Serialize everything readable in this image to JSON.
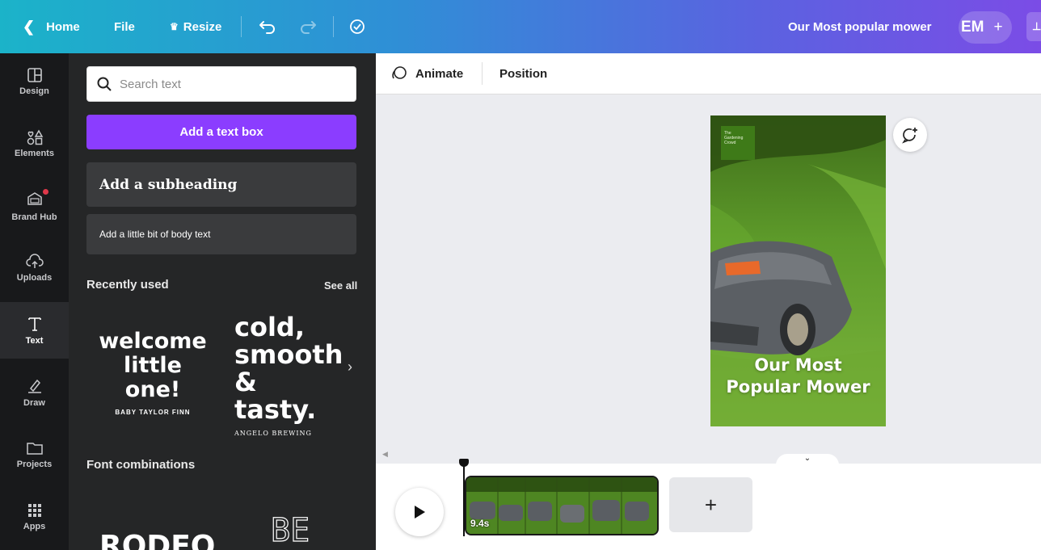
{
  "topbar": {
    "home_label": "Home",
    "file_label": "File",
    "resize_label": "Resize",
    "design_title": "Our Most popular mower",
    "avatar_initials": "EM",
    "avatar_add": "+"
  },
  "rail": {
    "items": [
      {
        "label": "Design",
        "icon": "layout-icon"
      },
      {
        "label": "Elements",
        "icon": "shapes-icon"
      },
      {
        "label": "Brand Hub",
        "icon": "brand-hub-icon"
      },
      {
        "label": "Uploads",
        "icon": "cloud-upload-icon"
      },
      {
        "label": "Text",
        "icon": "text-icon"
      },
      {
        "label": "Draw",
        "icon": "pen-icon"
      },
      {
        "label": "Projects",
        "icon": "folder-icon"
      },
      {
        "label": "Apps",
        "icon": "apps-grid-icon"
      }
    ]
  },
  "panel": {
    "search_placeholder": "Search text",
    "add_text_box": "Add a text box",
    "add_subheading": "Add a subheading",
    "add_body_text": "Add a little bit of body text",
    "recently_used": "Recently used",
    "see_all": "See all",
    "font_combinations": "Font combinations",
    "recent_previews": [
      {
        "line1": "welcome",
        "line2": "little one!",
        "caption": "BABY TAYLOR FINN"
      },
      {
        "line1": "cold,",
        "line2": "smooth",
        "line3": "& tasty.",
        "caption": "ANGELO BREWING"
      }
    ],
    "combo_previews": [
      "RODEO",
      "BE"
    ]
  },
  "toolbar": {
    "animate": "Animate",
    "position": "Position"
  },
  "canvas": {
    "logo_text": [
      "The",
      "Gardening",
      "Crowd"
    ],
    "headline_line1": "Our Most",
    "headline_line2": "Popular Mower"
  },
  "timeline": {
    "clip_duration": "9.4s",
    "add_page": "+"
  },
  "colors": {
    "accent_purple": "#8b3dff",
    "rail_bg": "#18191b",
    "panel_bg": "#252627",
    "canvas_bg": "#ebecf0"
  }
}
